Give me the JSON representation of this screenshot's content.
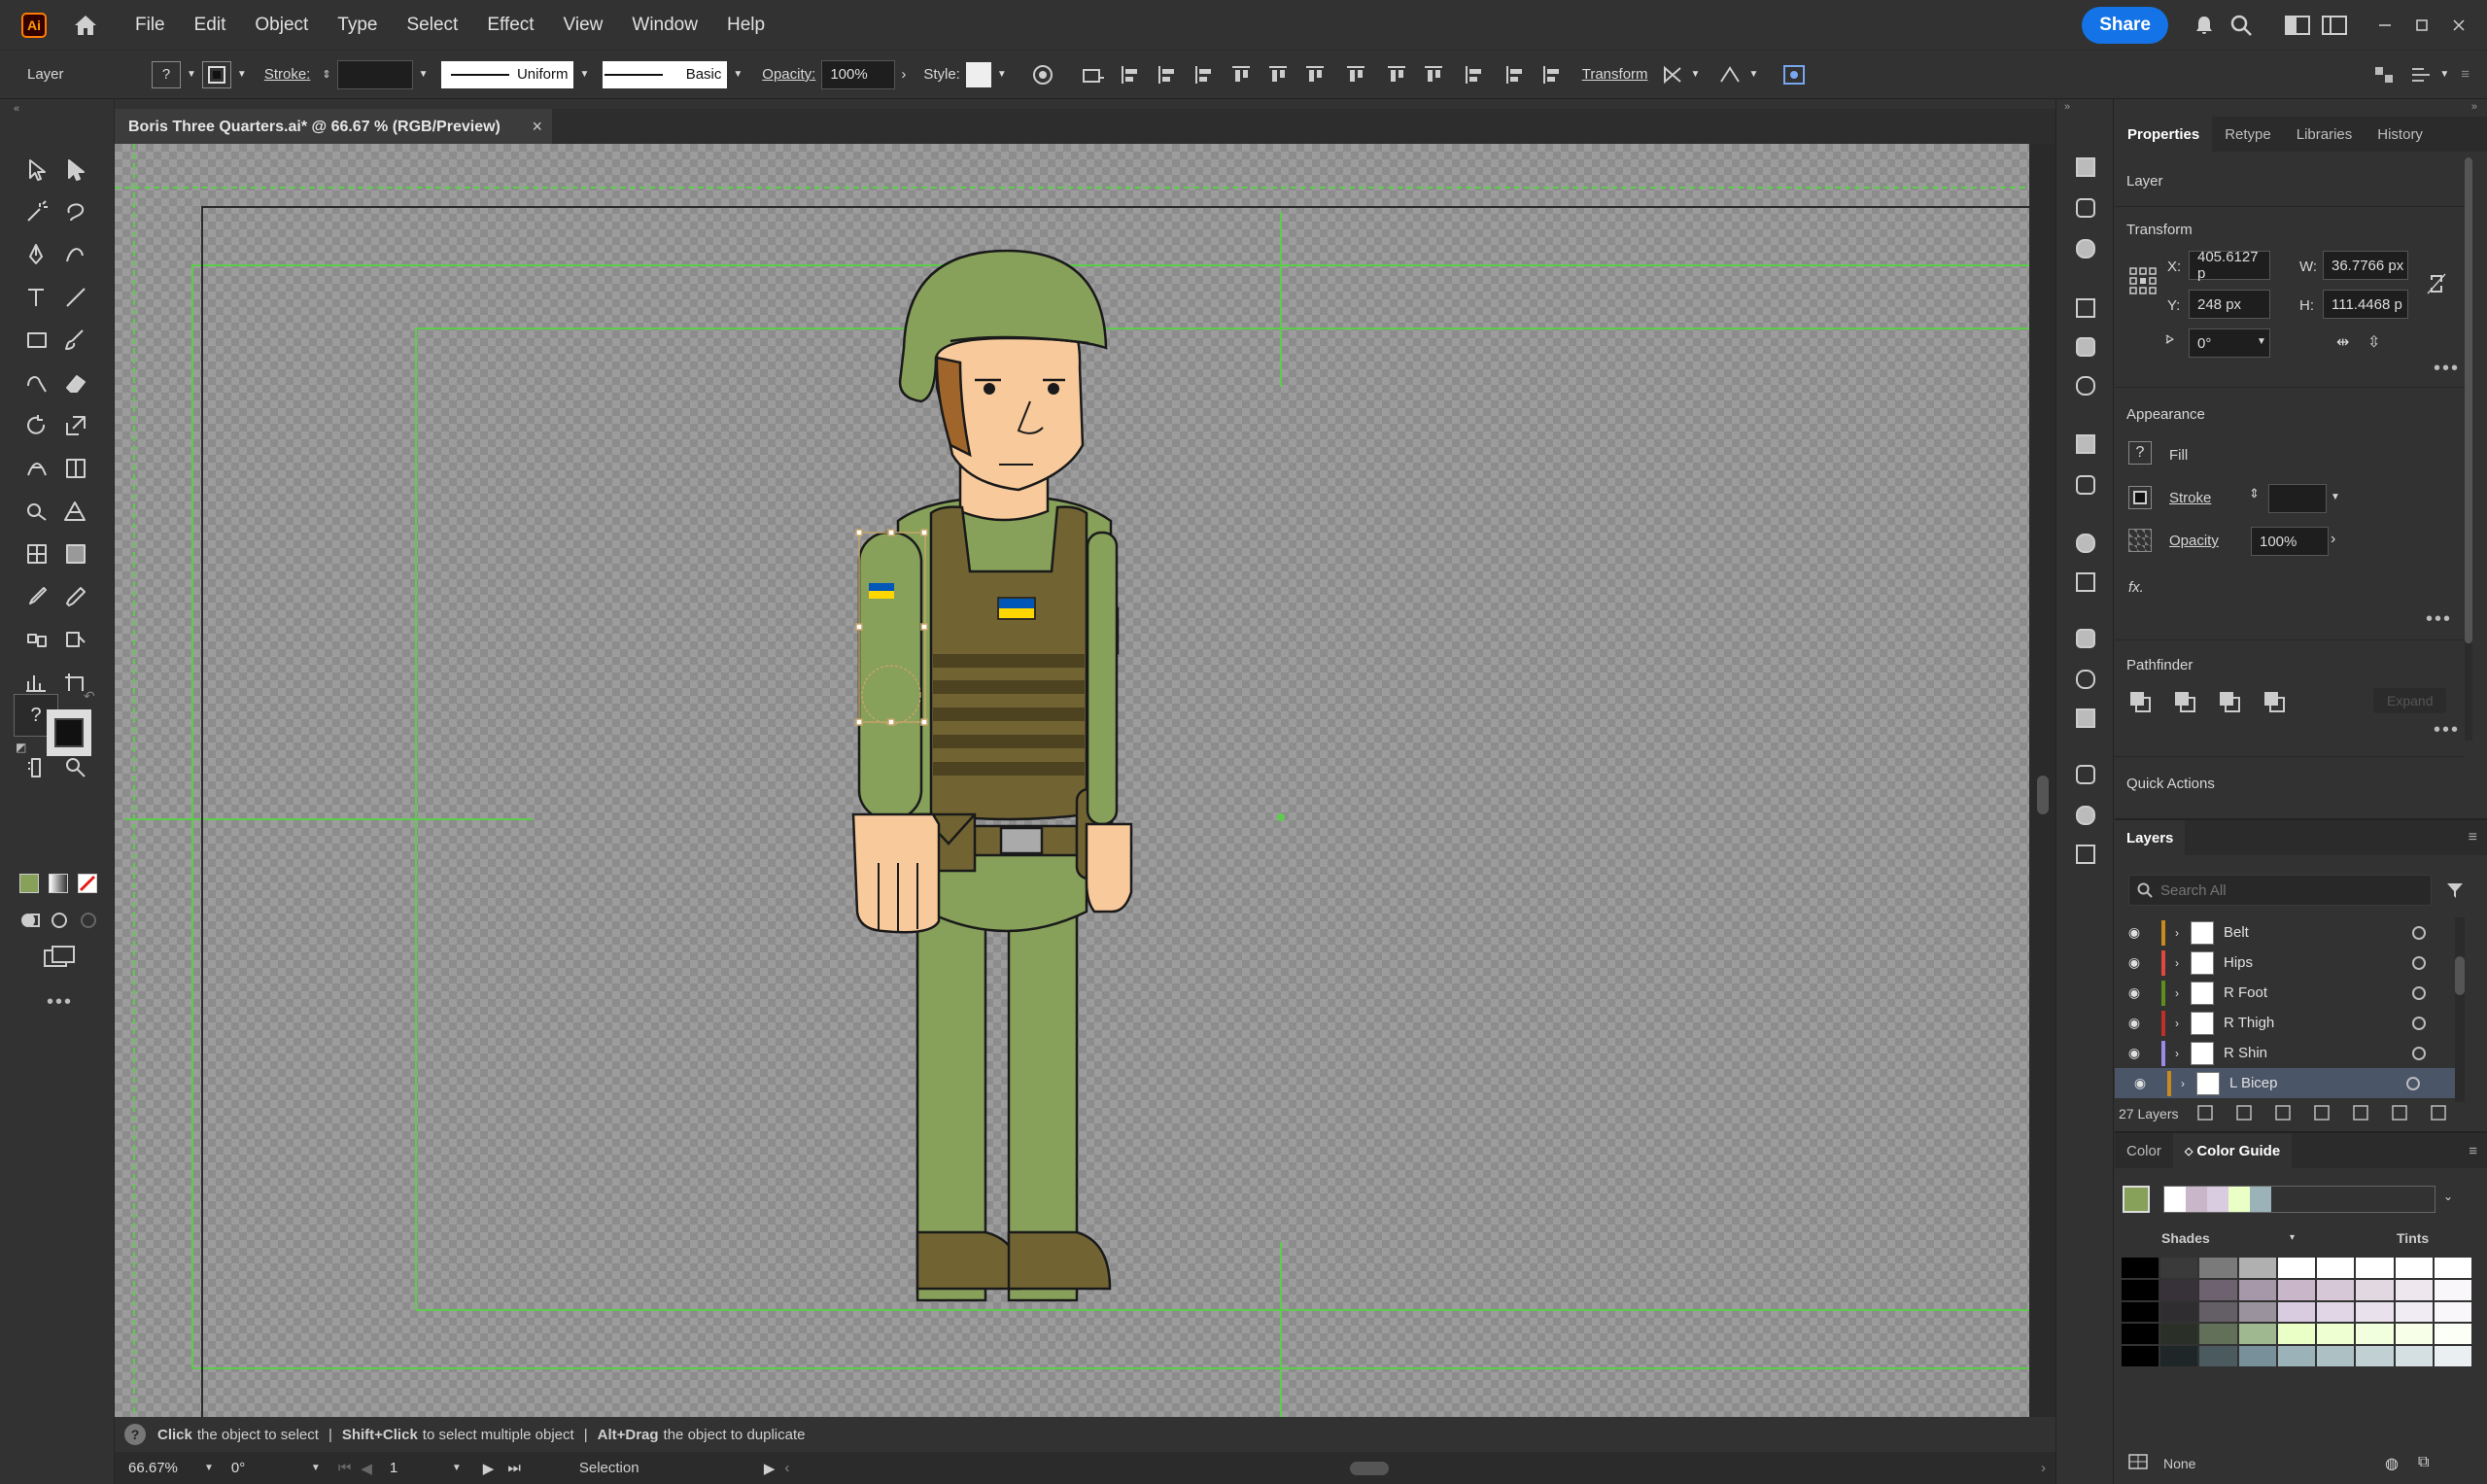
{
  "menubar": {
    "app_badge": "Ai",
    "items": [
      "File",
      "Edit",
      "Object",
      "Type",
      "Select",
      "Effect",
      "View",
      "Window",
      "Help"
    ],
    "share_label": "Share"
  },
  "control_bar": {
    "selection_label": "Layer",
    "stroke_label": "Stroke:",
    "profile_label": "Uniform",
    "brush_label": "Basic",
    "opacity_label": "Opacity:",
    "opacity_value": "100%",
    "style_label": "Style:",
    "transform_label": "Transform"
  },
  "document": {
    "tab_title": "Boris Three Quarters.ai* @ 66.67 % (RGB/Preview)",
    "close_glyph": "×"
  },
  "toolbar": {
    "fill_question": "?",
    "more": "•••"
  },
  "status": {
    "hint_click": "Click",
    "hint_click_text": "the object to select",
    "hint_shift": "Shift+Click",
    "hint_shift_text": "to select multiple object",
    "hint_alt": "Alt+Drag",
    "hint_alt_text": "the object to duplicate",
    "zoom": "66.67%",
    "rotation": "0°",
    "artboard": "1",
    "mode": "Selection"
  },
  "properties": {
    "tabs": [
      "Properties",
      "Retype",
      "Libraries",
      "History"
    ],
    "active_tab": "Properties",
    "kind": "Layer",
    "transform_title": "Transform",
    "x_label": "X:",
    "x_value": "405.6127 p",
    "y_label": "Y:",
    "y_value": "248 px",
    "w_label": "W:",
    "w_value": "36.7766 px",
    "h_label": "H:",
    "h_value": "111.4468 p",
    "angle_value": "0°",
    "appearance_title": "Appearance",
    "fill_label": "Fill",
    "fill_question": "?",
    "stroke_label": "Stroke",
    "opacity_label": "Opacity",
    "opacity_value": "100%",
    "fx_label": "fx.",
    "pathfinder_title": "Pathfinder",
    "expand_label": "Expand",
    "quick_actions_title": "Quick Actions",
    "more": "•••"
  },
  "layers": {
    "title": "Layers",
    "search_placeholder": "Search All",
    "rows": [
      {
        "name": "Belt",
        "color": "#c88a1e"
      },
      {
        "name": "Hips",
        "color": "#e0483f"
      },
      {
        "name": "R Foot",
        "color": "#5e8f1e"
      },
      {
        "name": "R Thigh",
        "color": "#c0302a"
      },
      {
        "name": "R Shin",
        "color": "#9a8ce6"
      },
      {
        "name": "L Bicep",
        "color": "#c88a1e"
      }
    ],
    "selected_index": 5,
    "count_label": "27 Layers"
  },
  "color_guide": {
    "tabs": [
      "Color",
      "Color Guide"
    ],
    "active_tab": "Color Guide",
    "shades_label": "Shades",
    "tints_label": "Tints",
    "none_label": "None",
    "harmony": [
      "#ffffff",
      "#c9b7c9",
      "#d9cbe0",
      "#eaffc6",
      "#9bb3b8"
    ],
    "base_color": "#87a05a"
  },
  "colors": {
    "accent": "#1473e6",
    "uniform": "#87a05a",
    "vest": "#726432",
    "skin": "#f8c99b",
    "guide": "#5dcc4c"
  }
}
